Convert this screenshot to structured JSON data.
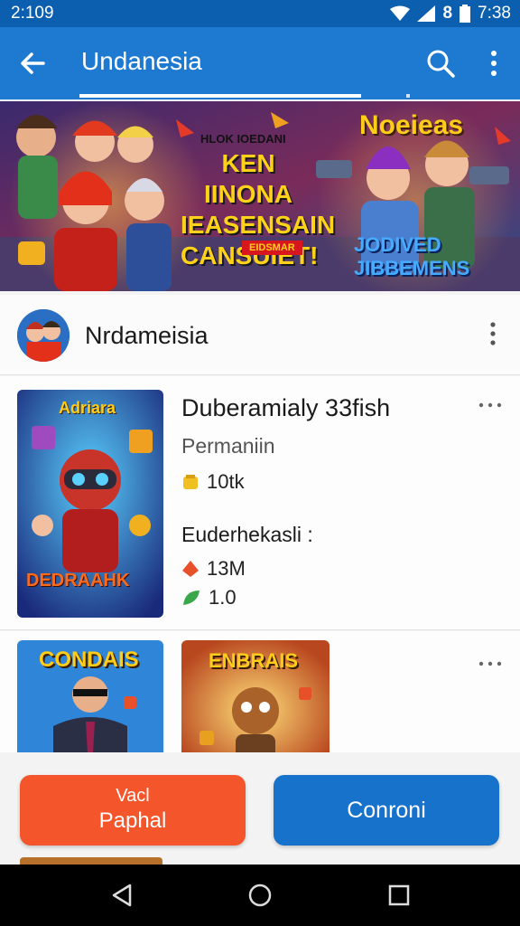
{
  "status_bar": {
    "time": "2:109",
    "right_time": "7:38",
    "right_glyph": "8"
  },
  "app_bar": {
    "title": "Undanesia"
  },
  "banner": {
    "kicker": "HLOK IOEDANI",
    "headline": "KEN IINONA IEASENSAIN CANSUIET!",
    "badge": "EIDSMAR",
    "logo_top": "Noeieas",
    "logo_bottom": "JODIVED JIBBEMENS"
  },
  "publisher": {
    "name": "Nrdameisia"
  },
  "game": {
    "cover_title": "Adriara",
    "cover_bottom": "DEDRAAHK",
    "title": "Duberamialy 33fish",
    "subtitle": "Permaniin",
    "rating": "10tk",
    "section_label": "Euderhekasli :",
    "downloads": "13M",
    "version": "1.0"
  },
  "thumbs": [
    {
      "label": "CONDAIS"
    },
    {
      "label": "ENBRAIS"
    }
  ],
  "buttons": {
    "primary_line1": "Vacl",
    "primary_line2": "Paphal",
    "secondary": "Conroni"
  },
  "colors": {
    "status_bar": "#0b5fae",
    "app_bar": "#1d7ad0",
    "primary_button": "#f4552a",
    "secondary_button": "#1772cc"
  },
  "icons": [
    "arrow-left-icon",
    "search-icon",
    "more-vert-icon",
    "more-horiz-icon",
    "coin-icon",
    "fire-icon",
    "leaf-icon",
    "wifi-icon",
    "signal-icon",
    "battery-icon",
    "nav-back-icon",
    "nav-home-icon",
    "nav-recent-icon"
  ]
}
